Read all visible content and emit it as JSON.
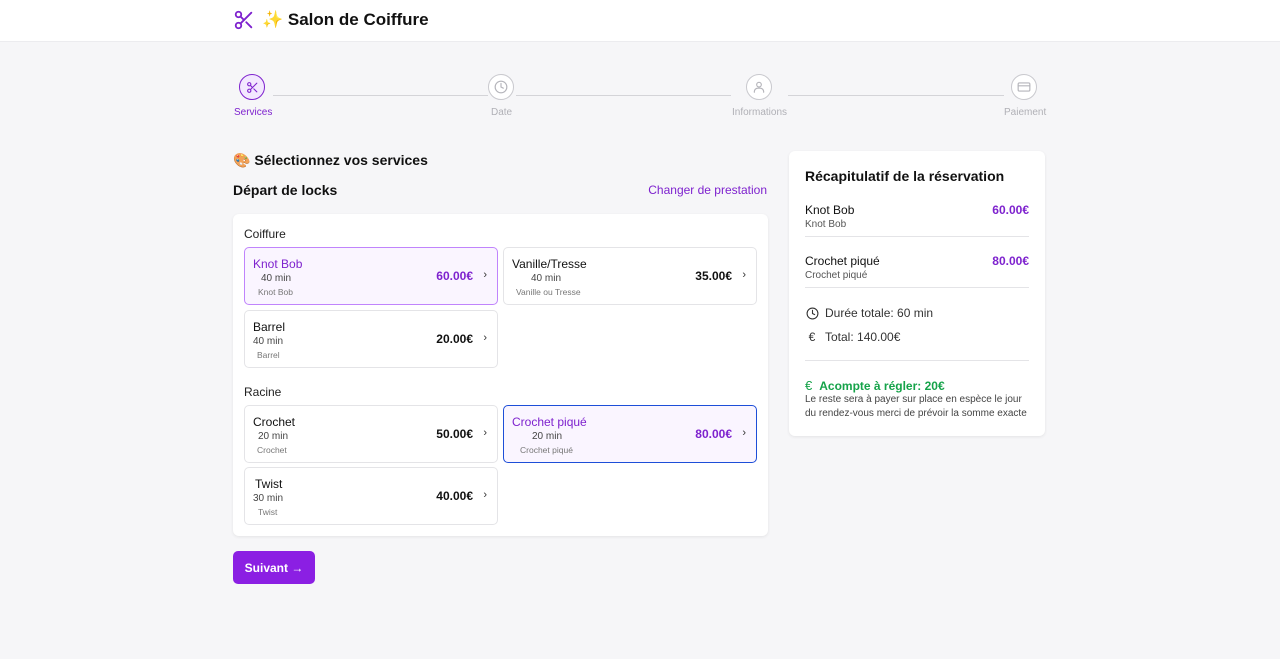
{
  "header": {
    "title": "✨ Salon de Coiffure",
    "logo_icon": "scissors-icon"
  },
  "steps": [
    {
      "label": "Services",
      "icon": "scissors-icon",
      "active": true
    },
    {
      "label": "Date",
      "icon": "clock-icon",
      "active": false
    },
    {
      "label": "Informations",
      "icon": "user-icon",
      "active": false
    },
    {
      "label": "Paiement",
      "icon": "credit-card-icon",
      "active": false
    }
  ],
  "main": {
    "section_title": "🎨 Sélectionnez vos services",
    "prestation_title": "Départ de locks",
    "change_link": "Changer de prestation",
    "categories": [
      {
        "name": "Coiffure",
        "services": [
          {
            "name": "Knot Bob",
            "duration": "40 min",
            "description": "Knot Bob",
            "price": "60.00€",
            "selected": true
          },
          {
            "name": "Vanille/Tresse",
            "duration": "40 min",
            "description": "Vanille ou Tresse",
            "price": "35.00€",
            "selected": false
          },
          {
            "name": "Barrel",
            "duration": "40 min",
            "description": "Barrel",
            "price": "20.00€",
            "selected": false
          }
        ]
      },
      {
        "name": "Racine",
        "services": [
          {
            "name": "Crochet",
            "duration": "20 min",
            "description": "Crochet",
            "price": "50.00€",
            "selected": false
          },
          {
            "name": "Crochet piqué",
            "duration": "20 min",
            "description": "Crochet piqué",
            "price": "80.00€",
            "selected": true
          },
          {
            "name": "Twist",
            "duration": "30 min",
            "description": "Twist",
            "price": "40.00€",
            "selected": false
          }
        ]
      }
    ],
    "next_button": "Suivant →"
  },
  "summary": {
    "title": "Récapitulatif de la réservation",
    "items": [
      {
        "name": "Knot Bob",
        "subtitle": "Knot Bob",
        "price": "60.00€"
      },
      {
        "name": "Crochet piqué",
        "subtitle": "Crochet piqué",
        "price": "80.00€"
      }
    ],
    "total_duration": "Durée totale: 60 min",
    "total": "Total: 140.00€",
    "deposit": "Acompte à régler: 20€",
    "note": "Le reste sera à payer sur place en espèce le jour du rendez-vous merci de prévoir la somme exacte"
  },
  "colors": {
    "accent": "#7e22ce",
    "button": "#8b1fe3",
    "success": "#16a34a",
    "selected_border": "#1d4ed8"
  }
}
